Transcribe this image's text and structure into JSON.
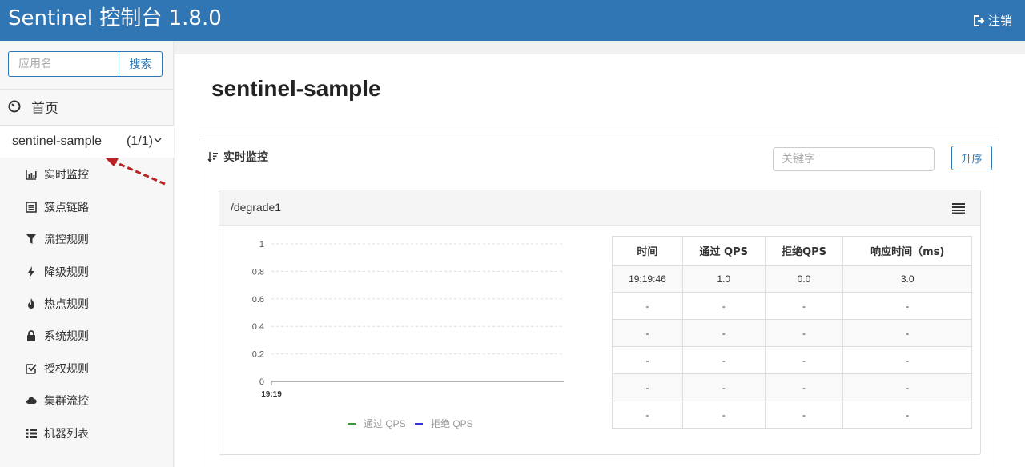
{
  "header": {
    "title": "Sentinel 控制台 1.8.0",
    "logout_label": "注销"
  },
  "sidebar": {
    "search_placeholder": "应用名",
    "search_button": "搜索",
    "home_label": "首页",
    "app": {
      "name": "sentinel-sample",
      "count": "(1/1)"
    },
    "items": [
      {
        "label": "实时监控",
        "icon": "bar-chart-icon"
      },
      {
        "label": "簇点链路",
        "icon": "list-alt-icon"
      },
      {
        "label": "流控规则",
        "icon": "filter-icon"
      },
      {
        "label": "降级规则",
        "icon": "flash-icon"
      },
      {
        "label": "热点规则",
        "icon": "fire-icon"
      },
      {
        "label": "系统规则",
        "icon": "lock-icon"
      },
      {
        "label": "授权规则",
        "icon": "check-icon"
      },
      {
        "label": "集群流控",
        "icon": "cloud-icon"
      },
      {
        "label": "机器列表",
        "icon": "th-list-icon"
      }
    ]
  },
  "main": {
    "title": "sentinel-sample",
    "panel_title": "实时监控",
    "keyword_placeholder": "关键字",
    "sort_button": "升序",
    "resource": {
      "name": "/degrade1",
      "table": {
        "headers": [
          "时间",
          "通过 QPS",
          "拒绝QPS",
          "响应时间（ms)"
        ],
        "rows": [
          [
            "19:19:46",
            "1.0",
            "0.0",
            "3.0"
          ],
          [
            "-",
            "-",
            "-",
            "-"
          ],
          [
            "-",
            "-",
            "-",
            "-"
          ],
          [
            "-",
            "-",
            "-",
            "-"
          ],
          [
            "-",
            "-",
            "-",
            "-"
          ],
          [
            "-",
            "-",
            "-",
            "-"
          ]
        ]
      }
    }
  },
  "chart_data": {
    "type": "line",
    "x": [
      "19:19"
    ],
    "yticks": [
      "1",
      "0.8",
      "0.6",
      "0.4",
      "0.2",
      "0"
    ],
    "ylim": [
      0,
      1
    ],
    "series": [
      {
        "name": "通过 QPS",
        "color": "#3a9a3a",
        "values": []
      },
      {
        "name": "拒绝 QPS",
        "color": "#3333dd",
        "values": []
      }
    ],
    "grid": true,
    "legend": "bottom"
  }
}
